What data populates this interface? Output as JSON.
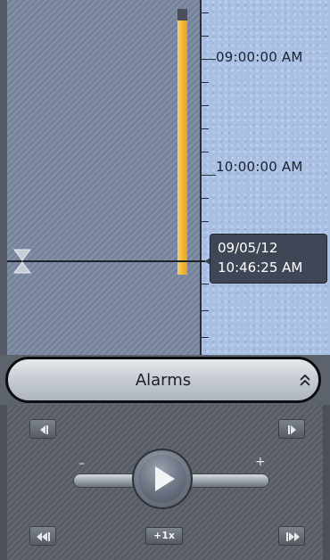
{
  "timeline": {
    "time_labels": [
      "09:00:00 AM",
      "10:00:00 AM"
    ],
    "cursor": {
      "date": "09/05/12",
      "time": "10:46:25 AM"
    }
  },
  "alarms": {
    "label": "Alarms"
  },
  "player": {
    "slower_sign": "–",
    "faster_sign": "+",
    "speed_label": "+1x"
  },
  "colors": {
    "archive_bar": "#f4b93a",
    "timeline_left": "#7d8aa4",
    "timeline_right": "#a9c0e4",
    "panel": "#5c6069"
  },
  "icons": {
    "cursor_marker": "hourglass-icon",
    "alarms_toggle": "double-chevron-up-icon",
    "frame_back": "step-back-icon",
    "frame_forward": "step-forward-icon",
    "play": "play-icon",
    "fast_back": "fast-back-icon",
    "fast_forward": "fast-forward-icon"
  }
}
